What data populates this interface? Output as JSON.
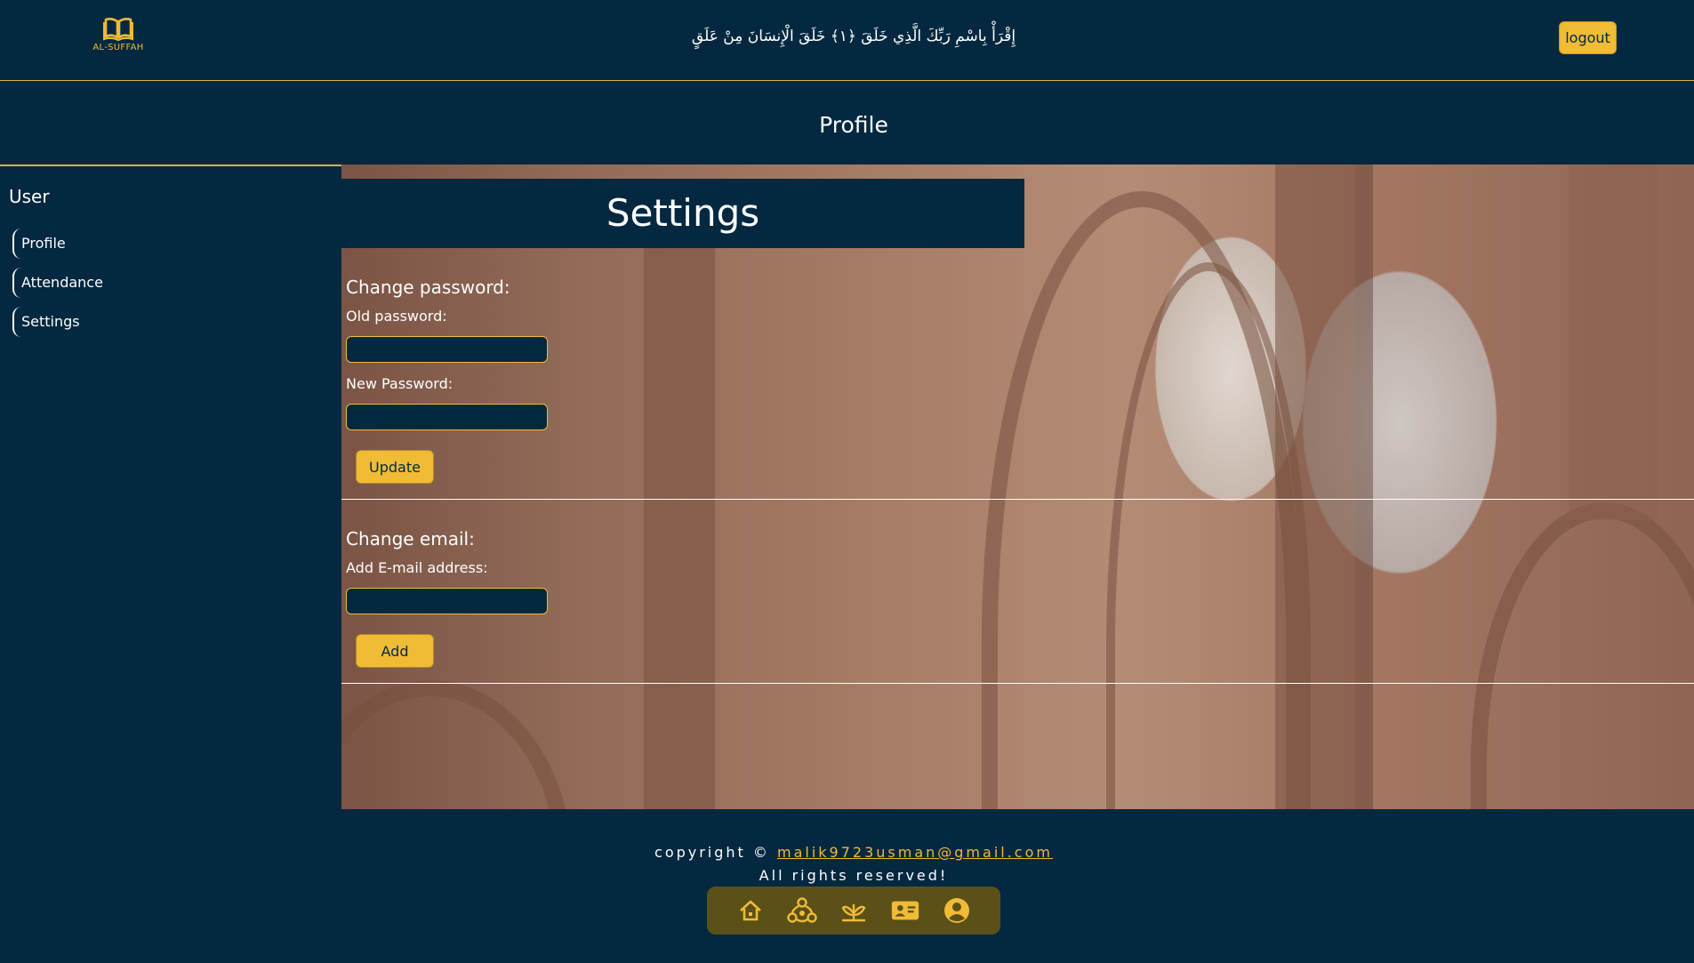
{
  "header": {
    "logo_text": "AL-SUFFAH",
    "verse": "إِقْرَأْ بِاسْمِ رَبِّكَ الَّذِي خَلَقَ ﴿١﴾ خَلَقَ الْإِنسَانَ مِنْ عَلَقٍ",
    "logout_label": "logout"
  },
  "page_title": "Profile",
  "sidebar": {
    "title": "User",
    "items": [
      {
        "label": "Profile"
      },
      {
        "label": "Attendance"
      },
      {
        "label": "Settings"
      }
    ]
  },
  "main": {
    "heading": "Settings",
    "password": {
      "title": "Change password:",
      "old_label": "Old password:",
      "new_label": "New Password:",
      "old_value": "",
      "new_value": "",
      "button_label": "Update"
    },
    "email": {
      "title": "Change email:",
      "label": "Add E-mail address:",
      "value": "",
      "button_label": "Add"
    }
  },
  "footer": {
    "copyright_prefix": "copyright ©",
    "email": "malik9723usman@gmail.com",
    "rights": "All rights reserved!",
    "nav_icons": [
      "home-icon",
      "network-icon",
      "plant-icon",
      "contact-card-icon",
      "user-circle-icon"
    ]
  },
  "colors": {
    "background": "#032840",
    "accent": "#f0bb35"
  }
}
